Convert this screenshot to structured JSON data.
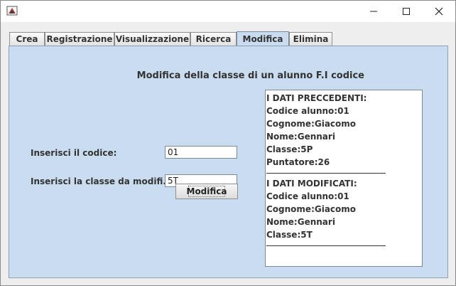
{
  "window": {
    "controls": {
      "minimize": "minimize-icon",
      "maximize": "maximize-icon",
      "close": "close-icon"
    }
  },
  "tabs": [
    {
      "label": "Crea",
      "active": false
    },
    {
      "label": "Registrazione",
      "active": false
    },
    {
      "label": "Visualizzazione",
      "active": false
    },
    {
      "label": "Ricerca",
      "active": false
    },
    {
      "label": "Modifica",
      "active": true
    },
    {
      "label": "Elimina",
      "active": false
    }
  ],
  "form": {
    "heading": "Modifica della classe di un alunno F.I codice",
    "codice_label": "Inserisci il codice:",
    "codice_value": "01",
    "classe_label": "Inserisci la classe da modifi...",
    "classe_value": "5T",
    "submit_label": "Modifica"
  },
  "output": {
    "previous_header": "I DATI PRECCEDENTI:",
    "previous": [
      "Codice alunno:01",
      "Cognome:Giacomo",
      "Nome:Gennari",
      "Classe:5P",
      "Puntatore:26"
    ],
    "modified_header": "I DATI MODIFICATI:",
    "modified": [
      "Codice alunno:01",
      "Cognome:Giacomo",
      "Nome:Gennari",
      "Classe:5T"
    ]
  },
  "colors": {
    "panel": "#c9dcf0",
    "border": "#8da0b4"
  }
}
